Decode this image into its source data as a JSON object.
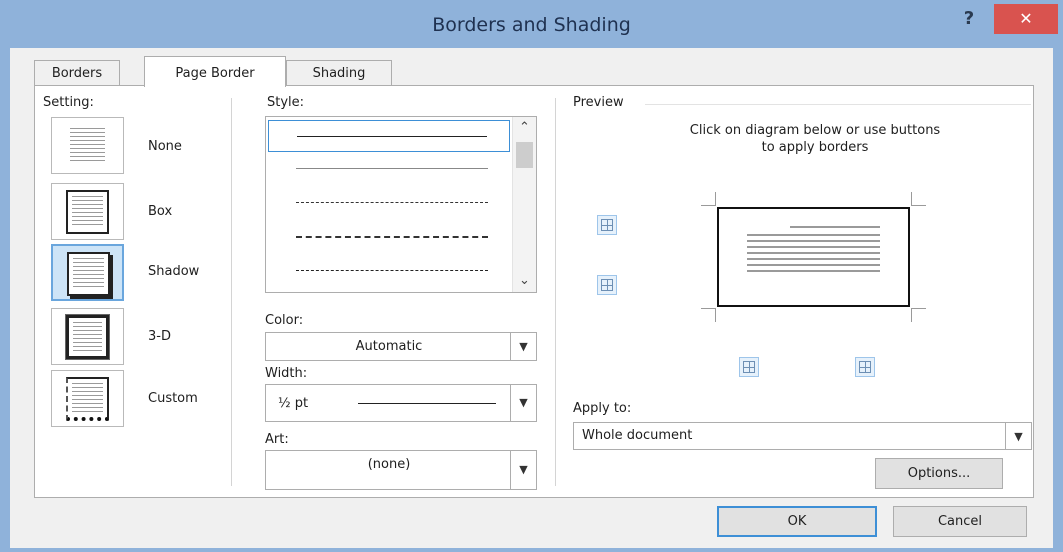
{
  "window": {
    "title": "Borders and Shading",
    "help_label": "?",
    "close_label": "✕"
  },
  "tabs": [
    {
      "label": "Borders"
    },
    {
      "label": "Page Border"
    },
    {
      "label": "Shading"
    }
  ],
  "setting": {
    "heading": "Setting:",
    "items": [
      {
        "label": "None",
        "icon": "setting-none-icon"
      },
      {
        "label": "Box",
        "icon": "setting-box-icon"
      },
      {
        "label": "Shadow",
        "icon": "setting-shadow-icon",
        "selected": true
      },
      {
        "label": "3-D",
        "icon": "setting-3d-icon"
      },
      {
        "label": "Custom",
        "icon": "setting-custom-icon"
      }
    ]
  },
  "style": {
    "heading": "Style:",
    "options": [
      "solid",
      "solid-thin",
      "dashed-fine",
      "dashed",
      "dash-dot"
    ],
    "selected_index": 0
  },
  "color": {
    "label": "Color:",
    "value": "Automatic"
  },
  "width": {
    "label": "Width:",
    "value": "½ pt"
  },
  "art": {
    "label": "Art:",
    "value": "(none)"
  },
  "preview": {
    "heading": "Preview",
    "instruction_line1": "Click on diagram below or use buttons",
    "instruction_line2": "to apply borders"
  },
  "apply_to": {
    "label": "Apply to:",
    "value": "Whole document"
  },
  "buttons": {
    "options": "Options...",
    "ok": "OK",
    "cancel": "Cancel"
  },
  "colors": {
    "titlebar": "#8fb2da",
    "close": "#d9534f",
    "accent": "#3d8fd6"
  }
}
